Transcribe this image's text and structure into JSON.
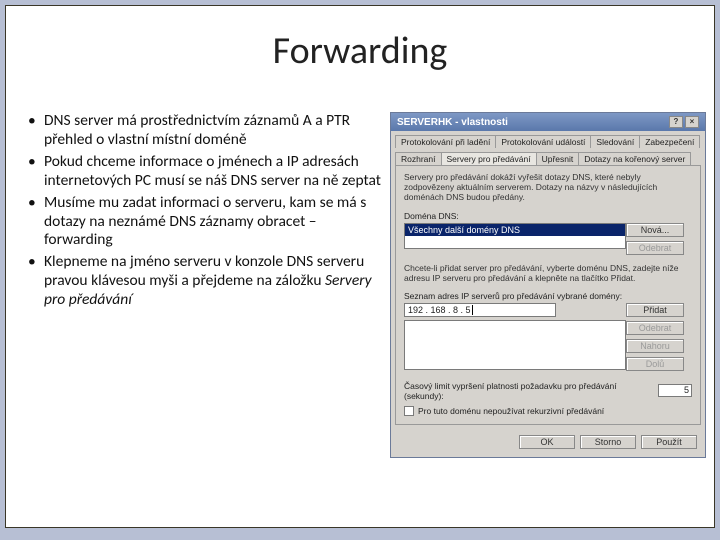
{
  "title": "Forwarding",
  "bullets": [
    "DNS server má prostřednictvím záznamů A a PTR přehled o vlastní místní doméně",
    "Pokud chceme informace o jménech a IP adresách internetových PC musí se náš DNS server na ně zeptat",
    "Musíme mu zadat informaci o serveru, kam se má s dotazy na neznámé DNS záznamy obracet – forwarding",
    "Klepneme na jméno serveru v konzole DNS serveru pravou klávesou myši a přejdeme na záložku <em>Servery pro předávání</em>"
  ],
  "dialog": {
    "title": "SERVERHK - vlastnosti",
    "tabs_row1": [
      "Protokolování při ladění",
      "Protokolování událostí",
      "Sledování",
      "Zabezpečení"
    ],
    "tabs_row2": [
      "Rozhraní",
      "Servery pro předávání",
      "Upřesnit",
      "Dotazy na kořenový server"
    ],
    "active_tab": "Servery pro předávání",
    "desc": "Servery pro předávání dokáží vyřešit dotazy DNS, které nebyly zodpovězeny aktuálním serverem. Dotazy na názvy v následujících doménách DNS budou předány.",
    "domain_label": "Doména DNS:",
    "domain_item": "Všechny další domény DNS",
    "btn_new": "Nová...",
    "btn_remove": "Odebrat",
    "desc2": "Chcete-li přidat server pro předávání, vyberte doménu DNS, zadejte níže adresu IP serveru pro předávání a klepněte na tlačítko Přidat.",
    "ip_label": "Seznam adres IP serverů pro předávání vybrané domény:",
    "ip_value": "192 . 168 . 8 . 5",
    "btn_add": "Přidat",
    "btn_del": "Odebrat",
    "btn_up": "Nahoru",
    "btn_down": "Dolů",
    "timeout_label": "Časový limit vypršení platnosti požadavku pro předávání (sekundy):",
    "timeout_value": "5",
    "checkbox_label": "Pro tuto doménu nepoužívat rekurzivní předávání",
    "ok": "OK",
    "cancel": "Storno",
    "apply": "Použít"
  }
}
